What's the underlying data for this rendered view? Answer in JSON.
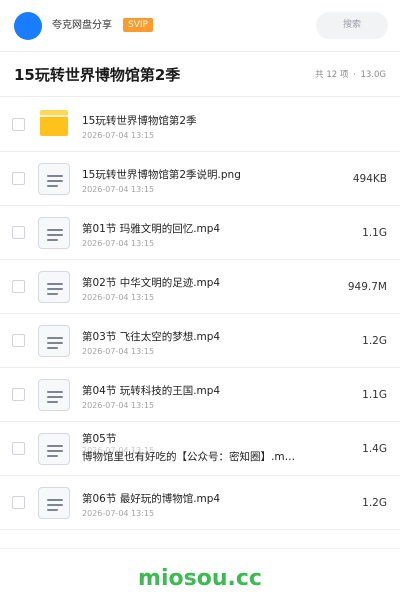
{
  "header": {
    "brand": "夸克网盘分享",
    "badge": "SVIP",
    "search_placeholder": "搜索"
  },
  "folder": {
    "title": "15玩转世界博物馆第2季",
    "count_text": "共 12 项",
    "dot": "·",
    "size_text": "13.0G"
  },
  "files": [
    {
      "name": "15玩转世界博物馆第2季",
      "date": "2026-07-04 13:15",
      "size": "",
      "icon": "folder-icon"
    },
    {
      "name": "15玩转世界博物馆第2季说明.png",
      "date": "2026-07-04 13:15",
      "size": "494KB",
      "icon": "document-icon"
    },
    {
      "name": "第01节 玛雅文明的回忆.mp4",
      "date": "2026-07-04 13:15",
      "size": "1.1G",
      "icon": "document-icon"
    },
    {
      "name": "第02节 中华文明的足迹.mp4",
      "date": "2026-07-04 13:15",
      "size": "949.7M",
      "icon": "document-icon"
    },
    {
      "name": "第03节 飞往太空的梦想.mp4",
      "date": "2026-07-04 13:15",
      "size": "1.2G",
      "icon": "document-icon"
    },
    {
      "name": "第04节 玩转科技的王国.mp4",
      "date": "2026-07-04 13:15",
      "size": "1.1G",
      "icon": "document-icon"
    },
    {
      "name_line1": "第05节",
      "name_line2": "博物馆里也有好吃的【公众号：密知圈】.m…",
      "date": "2026-07-04 13:15",
      "size": "1.4G",
      "icon": "document-icon"
    },
    {
      "name": "第06节 最好玩的博物馆.mp4",
      "date": "2026-07-04 13:15",
      "size": "1.2G",
      "icon": "document-icon"
    }
  ],
  "watermark": "miosou.cc"
}
